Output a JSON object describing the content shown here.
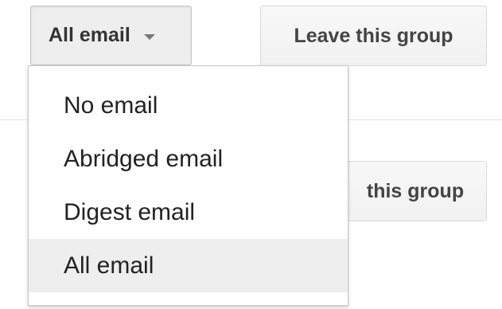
{
  "email_select": {
    "label": "All email"
  },
  "leave_button": {
    "label": "Leave this group"
  },
  "leave_button_partial": {
    "label": "this group"
  },
  "email_menu": {
    "items": [
      {
        "label": "No email"
      },
      {
        "label": "Abridged email"
      },
      {
        "label": "Digest email"
      },
      {
        "label": "All email"
      }
    ],
    "selected": "All email"
  },
  "colors": {
    "button_bg": "#f1f1f1",
    "button_border": "#d9d9d9",
    "selected_bg": "#eeeeee",
    "text": "#222222"
  },
  "icons": {
    "caret": "chevron-down-icon"
  }
}
